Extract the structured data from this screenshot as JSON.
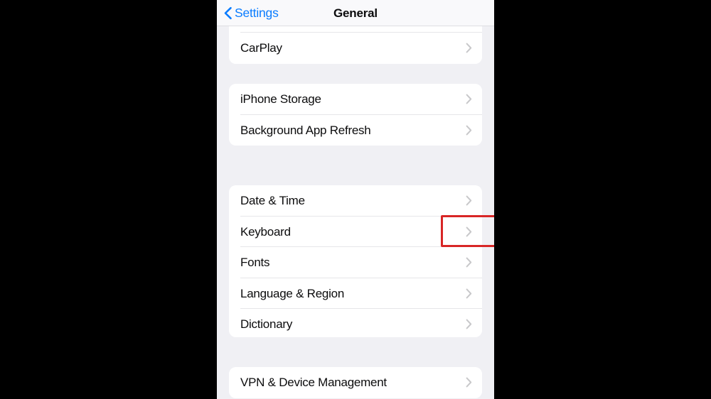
{
  "navbar": {
    "back_label": "Settings",
    "back_icon": "chevron-left-icon",
    "title": "General",
    "accent_color": "#0a7cff",
    "title_color": "#0b0b0c"
  },
  "theme": {
    "screen_background": "#f0f0f4",
    "card_background": "#ffffff",
    "separator_color": "#e6e6e9",
    "chevron_color": "#c4c4c6",
    "letterbox_color": "#000000",
    "highlight_color": "#d82626"
  },
  "groups": [
    {
      "id": "group-carplay",
      "rows": [
        {
          "label": "",
          "partial": true,
          "accessory": "chevron-right-icon"
        },
        {
          "label": "CarPlay",
          "partial": false,
          "accessory": "chevron-right-icon"
        }
      ]
    },
    {
      "id": "group-storage",
      "rows": [
        {
          "label": "iPhone Storage",
          "partial": false,
          "accessory": "chevron-right-icon"
        },
        {
          "label": "Background App Refresh",
          "partial": false,
          "accessory": "chevron-right-icon"
        }
      ]
    },
    {
      "id": "group-localization",
      "rows": [
        {
          "label": "Date & Time",
          "partial": false,
          "accessory": "chevron-right-icon"
        },
        {
          "label": "Keyboard",
          "partial": false,
          "accessory": "chevron-right-icon"
        },
        {
          "label": "Fonts",
          "partial": false,
          "accessory": "chevron-right-icon"
        },
        {
          "label": "Language & Region",
          "partial": false,
          "accessory": "chevron-right-icon"
        },
        {
          "label": "Dictionary",
          "partial": false,
          "accessory": "chevron-right-icon"
        }
      ]
    },
    {
      "id": "group-vpn",
      "rows": [
        {
          "label": "VPN & Device Management",
          "partial": false,
          "accessory": "chevron-right-icon"
        }
      ]
    }
  ],
  "annotation": {
    "target_row_label": "Keyboard",
    "shape": "rectangle",
    "color": "#d82626"
  }
}
